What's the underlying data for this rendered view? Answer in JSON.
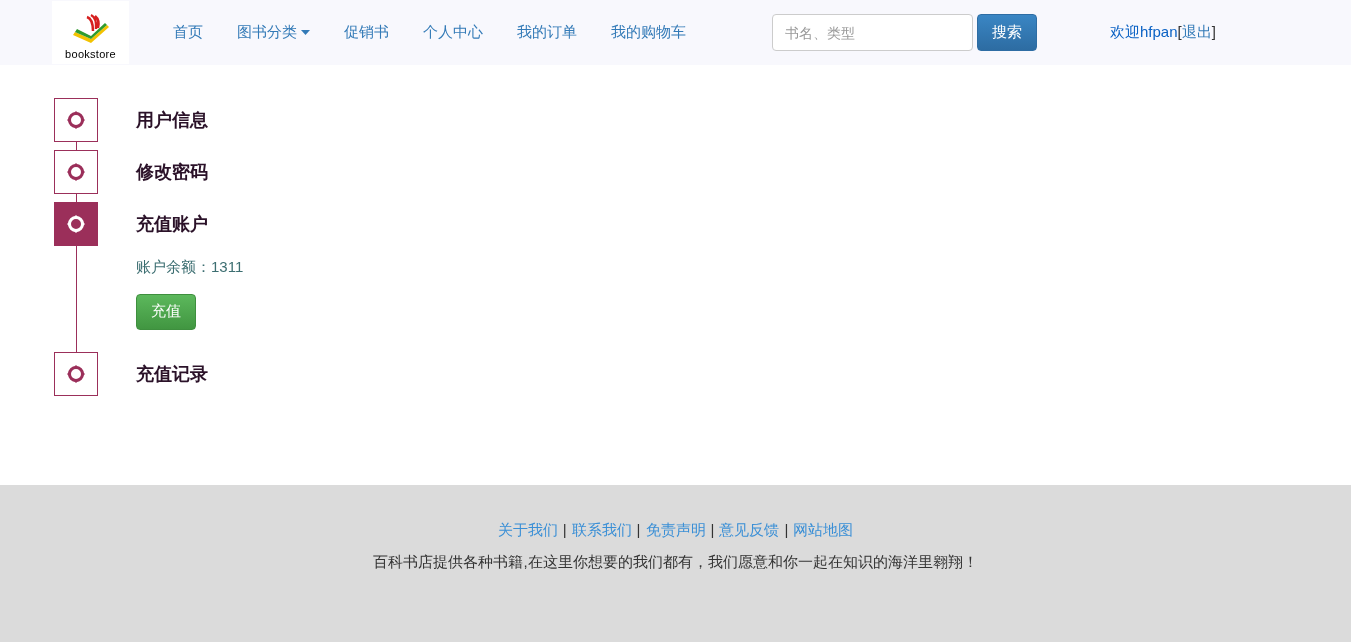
{
  "logo": {
    "text": "bookstore"
  },
  "nav": [
    {
      "label": "首页",
      "dropdown": false
    },
    {
      "label": "图书分类",
      "dropdown": true
    },
    {
      "label": "促销书",
      "dropdown": false
    },
    {
      "label": "个人中心",
      "dropdown": false
    },
    {
      "label": "我的订单",
      "dropdown": false
    },
    {
      "label": "我的购物车",
      "dropdown": false
    }
  ],
  "search": {
    "placeholder": "书名、类型",
    "button": "搜索"
  },
  "user": {
    "welcome": "欢迎hfpan",
    "open_bracket": "[",
    "logout": "退出",
    "close_bracket": "]"
  },
  "sections": [
    {
      "title": "用户信息",
      "selected": false
    },
    {
      "title": "修改密码",
      "selected": false
    },
    {
      "title": "充值账户",
      "selected": true,
      "balance": "账户余额：1311",
      "button": "充值"
    },
    {
      "title": "充值记录",
      "selected": false
    }
  ],
  "footer": {
    "separator": "|",
    "links": [
      "关于我们",
      "联系我们",
      "免责声明",
      "意见反馈",
      "网站地图"
    ],
    "tagline": "百科书店提供各种书籍,在这里你想要的我们都有，我们愿意和你一起在知识的海洋里翱翔！"
  }
}
